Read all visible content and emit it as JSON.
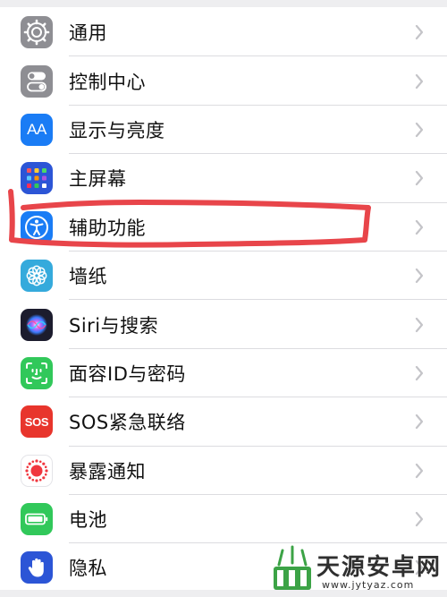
{
  "settings_list": {
    "items": [
      {
        "label": "通用",
        "icon": "gear-icon",
        "icon_bg": "#8e8e93"
      },
      {
        "label": "控制中心",
        "icon": "switches-icon",
        "icon_bg": "#8e8e93"
      },
      {
        "label": "显示与亮度",
        "icon": "text-size-icon",
        "icon_bg": "#1a7cf5"
      },
      {
        "label": "主屏幕",
        "icon": "app-grid-icon",
        "icon_bg": "#2c55d6"
      },
      {
        "label": "辅助功能",
        "icon": "accessibility-icon",
        "icon_bg": "#1a7cf5"
      },
      {
        "label": "墙纸",
        "icon": "flower-icon",
        "icon_bg": "#35aadc"
      },
      {
        "label": "Siri与搜索",
        "icon": "siri-icon",
        "icon_bg": "#1c1c2e"
      },
      {
        "label": "面容ID与密码",
        "icon": "face-id-icon",
        "icon_bg": "#31c85a"
      },
      {
        "label": "SOS紧急联络",
        "icon": "sos-icon",
        "icon_bg": "#e8352c"
      },
      {
        "label": "暴露通知",
        "icon": "exposure-icon",
        "icon_bg": "#ffffff"
      },
      {
        "label": "电池",
        "icon": "battery-icon",
        "icon_bg": "#31c85a"
      },
      {
        "label": "隐私",
        "icon": "hand-icon",
        "icon_bg": "#2c55d6"
      }
    ]
  },
  "icon_text": {
    "text_size": "AA",
    "sos": "SOS"
  },
  "annotation": {
    "color": "#e8454a",
    "highlighted_item": "辅助功能"
  },
  "watermark": {
    "title": "天源安卓网",
    "url": "www.jytyaz.com",
    "color": "#2f2f2f"
  }
}
